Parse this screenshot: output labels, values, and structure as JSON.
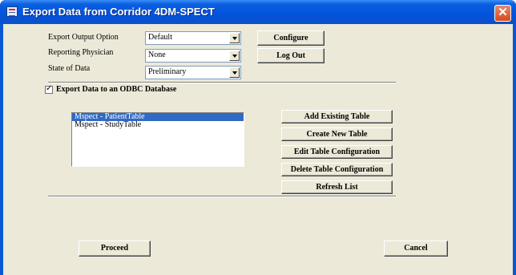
{
  "window": {
    "title": "Export Data from Corridor 4DM-SPECT"
  },
  "form": {
    "export_output": {
      "label": "Export Output Option",
      "value": "Default"
    },
    "reporting_physician": {
      "label": "Reporting Physician",
      "value": "None"
    },
    "state_of_data": {
      "label": "State of Data",
      "value": "Preliminary"
    }
  },
  "buttons": {
    "configure": "Configure",
    "log_out": "Log Out",
    "add_existing_table": "Add Existing Table",
    "create_new_table": "Create New Table",
    "edit_table_configuration": "Edit Table Configuration",
    "delete_table_configuration": "Delete Table Configuration",
    "refresh_list": "Refresh List",
    "proceed": "Proceed",
    "cancel": "Cancel"
  },
  "odbc": {
    "checkbox_label": "Export Data to an ODBC Database",
    "checked": true,
    "tables": [
      "Mspect - PatientTable",
      "Mspect - StudyTable"
    ],
    "selected_index": 0
  }
}
